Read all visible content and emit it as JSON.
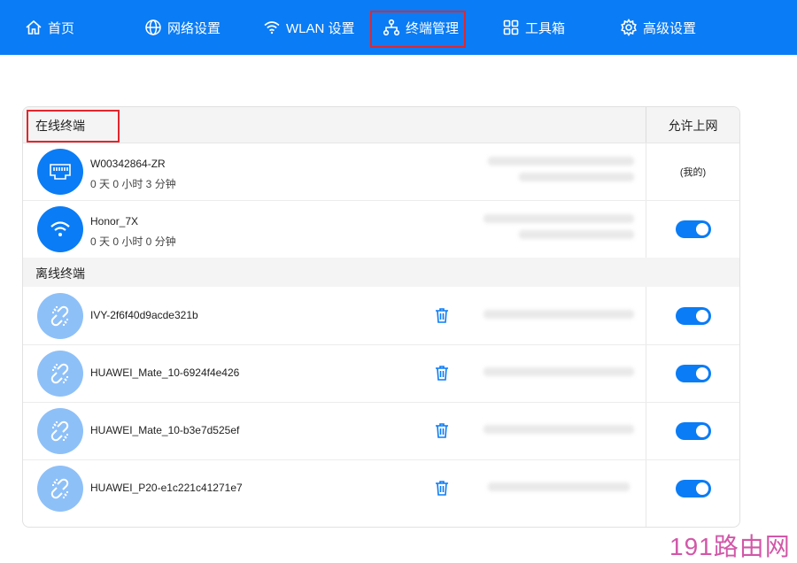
{
  "nav": {
    "items": [
      {
        "label": "首页",
        "icon": "home-icon"
      },
      {
        "label": "网络设置",
        "icon": "globe-icon"
      },
      {
        "label": "WLAN 设置",
        "icon": "wifi-icon"
      },
      {
        "label": "终端管理",
        "icon": "network-tree-icon"
      },
      {
        "label": "工具箱",
        "icon": "grid-icon"
      },
      {
        "label": "高级设置",
        "icon": "gear-icon"
      }
    ],
    "active": "终端管理"
  },
  "panel": {
    "online_header": "在线终端",
    "allow_header": "允许上网",
    "offline_header": "离线终端"
  },
  "online_devices": [
    {
      "name": "W00342864-ZR",
      "uptime": "0 天 0 小时 3 分钟",
      "type": "ethernet",
      "allow": "(我的)"
    },
    {
      "name": "Honor_7X",
      "uptime": "0 天 0 小时 0 分钟",
      "type": "wifi",
      "allow": "on"
    }
  ],
  "offline_devices": [
    {
      "name": "IVY-2f6f40d9acde321b",
      "allow": "on"
    },
    {
      "name": "HUAWEI_Mate_10-6924f4e426",
      "allow": "on"
    },
    {
      "name": "HUAWEI_Mate_10-b3e7d525ef",
      "allow": "on"
    },
    {
      "name": "HUAWEI_P20-e1c221c41271e7",
      "allow": "on"
    }
  ],
  "watermark": "191路由网",
  "colors": {
    "accent": "#0a7cf5",
    "highlight": "#e3262d",
    "offline_avatar": "#8ec0f8"
  }
}
